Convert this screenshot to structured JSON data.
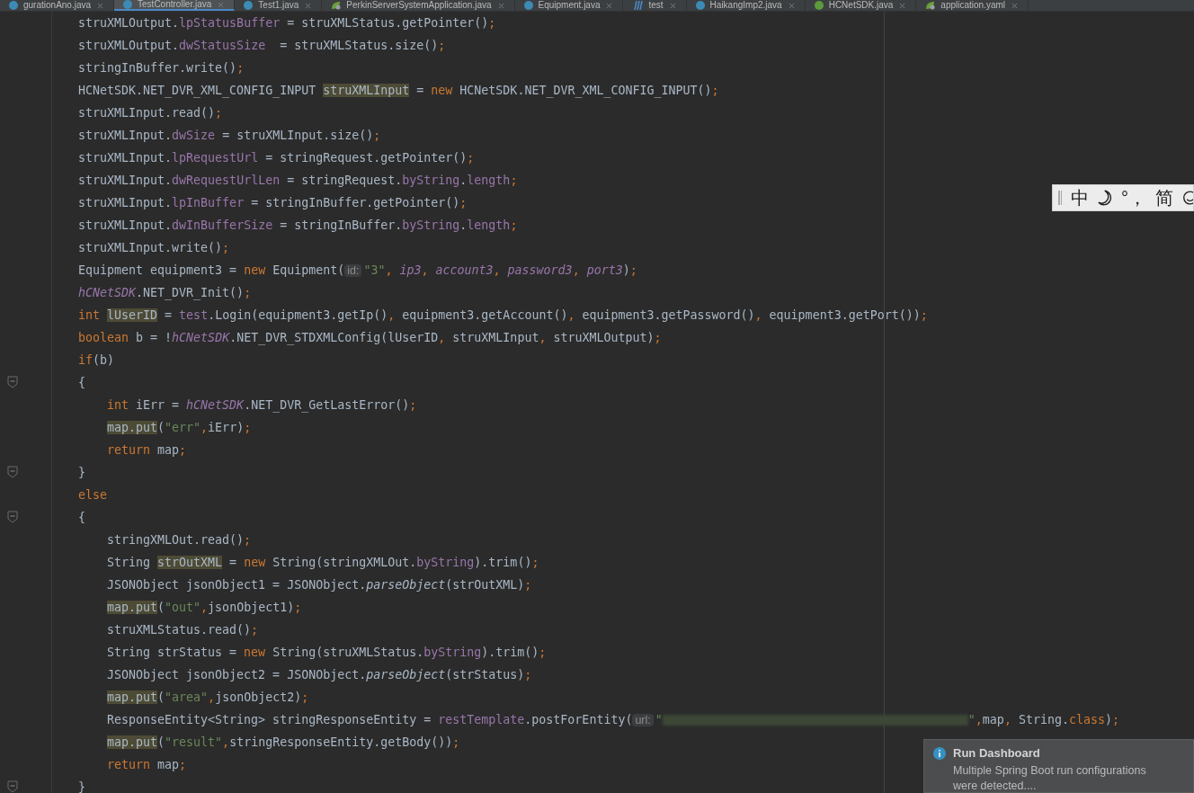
{
  "editor_tabs": [
    {
      "label": "gurationAno.java",
      "kind": "class",
      "selected": false
    },
    {
      "label": "TestController.java",
      "kind": "class",
      "selected": true
    },
    {
      "label": "Test1.java",
      "kind": "class",
      "selected": false
    },
    {
      "label": "PerkinServerSystemApplication.java",
      "kind": "spring",
      "selected": false
    },
    {
      "label": "Equipment.java",
      "kind": "class",
      "selected": false
    },
    {
      "label": "test",
      "kind": "sql",
      "selected": false
    },
    {
      "label": "HaikangImp2.java",
      "kind": "class",
      "selected": false
    },
    {
      "label": "HCNetSDK.java",
      "kind": "interface",
      "selected": false
    },
    {
      "label": "application.yaml",
      "kind": "spring",
      "selected": false
    }
  ],
  "code": {
    "lines": [
      {
        "fold_marker": false,
        "tokens": [
          {
            "text": "struXMLOutput.",
            "kind": "plain"
          },
          {
            "text": "lpStatusBuffer",
            "kind": "field"
          },
          {
            "text": " = struXMLStatus.getPointer()",
            "kind": "plain"
          },
          {
            "text": ";",
            "kind": "keyword"
          }
        ]
      },
      {
        "fold_marker": false,
        "tokens": [
          {
            "text": "struXMLOutput.",
            "kind": "plain"
          },
          {
            "text": "dwStatusSize",
            "kind": "field"
          },
          {
            "text": "  = struXMLStatus.size()",
            "kind": "plain"
          },
          {
            "text": ";",
            "kind": "keyword"
          }
        ]
      },
      {
        "fold_marker": false,
        "tokens": [
          {
            "text": "stringInBuffer.write()",
            "kind": "plain"
          },
          {
            "text": ";",
            "kind": "keyword"
          }
        ]
      },
      {
        "fold_marker": false,
        "tokens": [
          {
            "text": "HCNetSDK.NET_DVR_XML_CONFIG_INPUT ",
            "kind": "plain"
          },
          {
            "text": "struXMLInput",
            "kind": "usage"
          },
          {
            "text": " = ",
            "kind": "plain"
          },
          {
            "text": "new",
            "kind": "keyword"
          },
          {
            "text": " HCNetSDK.NET_DVR_XML_CONFIG_INPUT()",
            "kind": "plain"
          },
          {
            "text": ";",
            "kind": "keyword"
          }
        ]
      },
      {
        "fold_marker": false,
        "tokens": [
          {
            "text": "struXMLInput.read()",
            "kind": "plain"
          },
          {
            "text": ";",
            "kind": "keyword"
          }
        ]
      },
      {
        "fold_marker": false,
        "tokens": [
          {
            "text": "struXMLInput.",
            "kind": "plain"
          },
          {
            "text": "dwSize",
            "kind": "field"
          },
          {
            "text": " = struXMLInput.size()",
            "kind": "plain"
          },
          {
            "text": ";",
            "kind": "keyword"
          }
        ]
      },
      {
        "fold_marker": false,
        "tokens": [
          {
            "text": "struXMLInput.",
            "kind": "plain"
          },
          {
            "text": "lpRequestUrl",
            "kind": "field"
          },
          {
            "text": " = stringRequest.getPointer()",
            "kind": "plain"
          },
          {
            "text": ";",
            "kind": "keyword"
          }
        ]
      },
      {
        "fold_marker": false,
        "tokens": [
          {
            "text": "struXMLInput.",
            "kind": "plain"
          },
          {
            "text": "dwRequestUrlLen",
            "kind": "field"
          },
          {
            "text": " = stringRequest.",
            "kind": "plain"
          },
          {
            "text": "byString",
            "kind": "field"
          },
          {
            "text": ".",
            "kind": "plain"
          },
          {
            "text": "length",
            "kind": "field"
          },
          {
            "text": ";",
            "kind": "keyword"
          }
        ]
      },
      {
        "fold_marker": false,
        "tokens": [
          {
            "text": "struXMLInput.",
            "kind": "plain"
          },
          {
            "text": "lpInBuffer",
            "kind": "field"
          },
          {
            "text": " = stringInBuffer.getPointer()",
            "kind": "plain"
          },
          {
            "text": ";",
            "kind": "keyword"
          }
        ]
      },
      {
        "fold_marker": false,
        "tokens": [
          {
            "text": "struXMLInput.",
            "kind": "plain"
          },
          {
            "text": "dwInBufferSize",
            "kind": "field"
          },
          {
            "text": " = stringInBuffer.",
            "kind": "plain"
          },
          {
            "text": "byString",
            "kind": "field"
          },
          {
            "text": ".",
            "kind": "plain"
          },
          {
            "text": "length",
            "kind": "field"
          },
          {
            "text": ";",
            "kind": "keyword"
          }
        ]
      },
      {
        "fold_marker": false,
        "tokens": [
          {
            "text": "struXMLInput.write()",
            "kind": "plain"
          },
          {
            "text": ";",
            "kind": "keyword"
          }
        ]
      },
      {
        "fold_marker": false,
        "tokens": [
          {
            "text": "Equipment equipment3 = ",
            "kind": "plain"
          },
          {
            "text": "new",
            "kind": "keyword"
          },
          {
            "text": " Equipment(",
            "kind": "plain"
          },
          {
            "text": "id:",
            "kind": "hint"
          },
          {
            "text": "\"3\"",
            "kind": "string"
          },
          {
            "text": ", ",
            "kind": "keyword"
          },
          {
            "text": "ip3",
            "kind": "static"
          },
          {
            "text": ", ",
            "kind": "keyword"
          },
          {
            "text": "account3",
            "kind": "static"
          },
          {
            "text": ", ",
            "kind": "keyword"
          },
          {
            "text": "password3",
            "kind": "static"
          },
          {
            "text": ", ",
            "kind": "keyword"
          },
          {
            "text": "port3",
            "kind": "static"
          },
          {
            "text": ")",
            "kind": "plain"
          },
          {
            "text": ";",
            "kind": "keyword"
          }
        ]
      },
      {
        "fold_marker": false,
        "tokens": [
          {
            "text": "hCNetSDK",
            "kind": "static"
          },
          {
            "text": ".NET_DVR_Init()",
            "kind": "plain"
          },
          {
            "text": ";",
            "kind": "keyword"
          }
        ]
      },
      {
        "fold_marker": false,
        "tokens": [
          {
            "text": "int ",
            "kind": "keyword"
          },
          {
            "text": "lUserID",
            "kind": "usage"
          },
          {
            "text": " = ",
            "kind": "plain"
          },
          {
            "text": "test",
            "kind": "field"
          },
          {
            "text": ".Login(equipment3.getIp()",
            "kind": "plain"
          },
          {
            "text": ", ",
            "kind": "keyword"
          },
          {
            "text": "equipment3.getAccount()",
            "kind": "plain"
          },
          {
            "text": ", ",
            "kind": "keyword"
          },
          {
            "text": "equipment3.getPassword()",
            "kind": "plain"
          },
          {
            "text": ", ",
            "kind": "keyword"
          },
          {
            "text": "equipment3.getPort())",
            "kind": "plain"
          },
          {
            "text": ";",
            "kind": "keyword"
          }
        ]
      },
      {
        "fold_marker": false,
        "tokens": [
          {
            "text": "boolean",
            "kind": "keyword"
          },
          {
            "text": " b = !",
            "kind": "plain"
          },
          {
            "text": "hCNetSDK",
            "kind": "static"
          },
          {
            "text": ".NET_DVR_STDXMLConfig(lUserID",
            "kind": "plain"
          },
          {
            "text": ", ",
            "kind": "keyword"
          },
          {
            "text": "struXMLInput",
            "kind": "plain"
          },
          {
            "text": ", ",
            "kind": "keyword"
          },
          {
            "text": "struXMLOutput)",
            "kind": "plain"
          },
          {
            "text": ";",
            "kind": "keyword"
          }
        ]
      },
      {
        "fold_marker": false,
        "tokens": [
          {
            "text": "if",
            "kind": "keyword"
          },
          {
            "text": "(b)",
            "kind": "plain"
          }
        ]
      },
      {
        "fold_marker": true,
        "tokens": [
          {
            "text": "{",
            "kind": "plain"
          }
        ],
        "children": [
          {
            "tokens": [
              {
                "text": "int",
                "kind": "keyword"
              },
              {
                "text": " iErr = ",
                "kind": "plain"
              },
              {
                "text": "hCNetSDK",
                "kind": "static"
              },
              {
                "text": ".NET_DVR_GetLastError()",
                "kind": "plain"
              },
              {
                "text": ";",
                "kind": "keyword"
              }
            ]
          },
          {
            "tokens": [
              {
                "text": "map.put",
                "kind": "usage"
              },
              {
                "text": "(",
                "kind": "plain"
              },
              {
                "text": "\"err\"",
                "kind": "string"
              },
              {
                "text": ",",
                "kind": "keyword"
              },
              {
                "text": "iErr)",
                "kind": "plain"
              },
              {
                "text": ";",
                "kind": "keyword"
              }
            ]
          },
          {
            "tokens": [
              {
                "text": "return",
                "kind": "keyword"
              },
              {
                "text": " map",
                "kind": "plain"
              },
              {
                "text": ";",
                "kind": "keyword"
              }
            ]
          }
        ]
      },
      {
        "fold_marker": true,
        "tokens": [
          {
            "text": "}",
            "kind": "plain"
          }
        ]
      },
      {
        "fold_marker": false,
        "tokens": [
          {
            "text": "else",
            "kind": "keyword"
          }
        ]
      },
      {
        "fold_marker": true,
        "tokens": [
          {
            "text": "{",
            "kind": "plain"
          }
        ],
        "children": [
          {
            "tokens": [
              {
                "text": "stringXMLOut.read()",
                "kind": "plain"
              },
              {
                "text": ";",
                "kind": "keyword"
              }
            ]
          },
          {
            "tokens": [
              {
                "text": "String ",
                "kind": "plain"
              },
              {
                "text": "strOutXML",
                "kind": "usage"
              },
              {
                "text": " = ",
                "kind": "plain"
              },
              {
                "text": "new",
                "kind": "keyword"
              },
              {
                "text": " String(stringXMLOut.",
                "kind": "plain"
              },
              {
                "text": "byString",
                "kind": "field"
              },
              {
                "text": ").trim()",
                "kind": "plain"
              },
              {
                "text": ";",
                "kind": "keyword"
              }
            ]
          },
          {
            "tokens": [
              {
                "text": "JSONObject jsonObject1 = JSONObject.",
                "kind": "plain"
              },
              {
                "text": "parseObject",
                "kind": "italic"
              },
              {
                "text": "(strOutXML)",
                "kind": "plain"
              },
              {
                "text": ";",
                "kind": "keyword"
              }
            ]
          },
          {
            "tokens": [
              {
                "text": "map.put",
                "kind": "usage"
              },
              {
                "text": "(",
                "kind": "plain"
              },
              {
                "text": "\"out\"",
                "kind": "string"
              },
              {
                "text": ",",
                "kind": "keyword"
              },
              {
                "text": "jsonObject1)",
                "kind": "plain"
              },
              {
                "text": ";",
                "kind": "keyword"
              }
            ]
          },
          {
            "tokens": [
              {
                "text": "struXMLStatus.read()",
                "kind": "plain"
              },
              {
                "text": ";",
                "kind": "keyword"
              }
            ]
          },
          {
            "tokens": [
              {
                "text": "String strStatus = ",
                "kind": "plain"
              },
              {
                "text": "new",
                "kind": "keyword"
              },
              {
                "text": " String(struXMLStatus.",
                "kind": "plain"
              },
              {
                "text": "byString",
                "kind": "field"
              },
              {
                "text": ").trim()",
                "kind": "plain"
              },
              {
                "text": ";",
                "kind": "keyword"
              }
            ]
          },
          {
            "tokens": [
              {
                "text": "JSONObject jsonObject2 = JSONObject.",
                "kind": "plain"
              },
              {
                "text": "parseObject",
                "kind": "italic"
              },
              {
                "text": "(strStatus)",
                "kind": "plain"
              },
              {
                "text": ";",
                "kind": "keyword"
              }
            ]
          },
          {
            "tokens": [
              {
                "text": "map.put",
                "kind": "usage"
              },
              {
                "text": "(",
                "kind": "plain"
              },
              {
                "text": "\"area\"",
                "kind": "string"
              },
              {
                "text": ",",
                "kind": "keyword"
              },
              {
                "text": "jsonObject2)",
                "kind": "plain"
              },
              {
                "text": ";",
                "kind": "keyword"
              }
            ]
          },
          {
            "tokens": [
              {
                "text": "ResponseEntity<String> stringResponseEntity = ",
                "kind": "plain"
              },
              {
                "text": "restTemplate",
                "kind": "field"
              },
              {
                "text": ".postForEntity(",
                "kind": "plain"
              },
              {
                "text": "url:",
                "kind": "hint"
              },
              {
                "text": "\"",
                "kind": "string"
              },
              {
                "kind": "redacted"
              },
              {
                "text": "\"",
                "kind": "string"
              },
              {
                "text": ",",
                "kind": "keyword"
              },
              {
                "text": "map",
                "kind": "plain"
              },
              {
                "text": ", ",
                "kind": "keyword"
              },
              {
                "text": "String.",
                "kind": "plain"
              },
              {
                "text": "class",
                "kind": "keyword"
              },
              {
                "text": ")",
                "kind": "plain"
              },
              {
                "text": ";",
                "kind": "keyword"
              }
            ]
          },
          {
            "tokens": [
              {
                "text": "map.put",
                "kind": "usage"
              },
              {
                "text": "(",
                "kind": "plain"
              },
              {
                "text": "\"result\"",
                "kind": "string"
              },
              {
                "text": ",",
                "kind": "keyword"
              },
              {
                "text": "stringResponseEntity.getBody())",
                "kind": "plain"
              },
              {
                "text": ";",
                "kind": "keyword"
              }
            ]
          },
          {
            "tokens": [
              {
                "text": "return",
                "kind": "keyword"
              },
              {
                "text": " map",
                "kind": "plain"
              },
              {
                "text": ";",
                "kind": "keyword"
              }
            ]
          }
        ]
      },
      {
        "fold_marker": true,
        "tokens": [
          {
            "text": "}",
            "kind": "plain"
          }
        ]
      }
    ]
  },
  "ime_toolbar": {
    "items": [
      {
        "kind": "grip"
      },
      {
        "kind": "text",
        "text": "中"
      },
      {
        "kind": "moon"
      },
      {
        "kind": "text",
        "text": "°，"
      },
      {
        "kind": "text",
        "text": "简"
      },
      {
        "kind": "smiley"
      }
    ]
  },
  "notification": {
    "title": "Run Dashboard",
    "message": "Multiple Spring Boot run configurations were detected...."
  }
}
